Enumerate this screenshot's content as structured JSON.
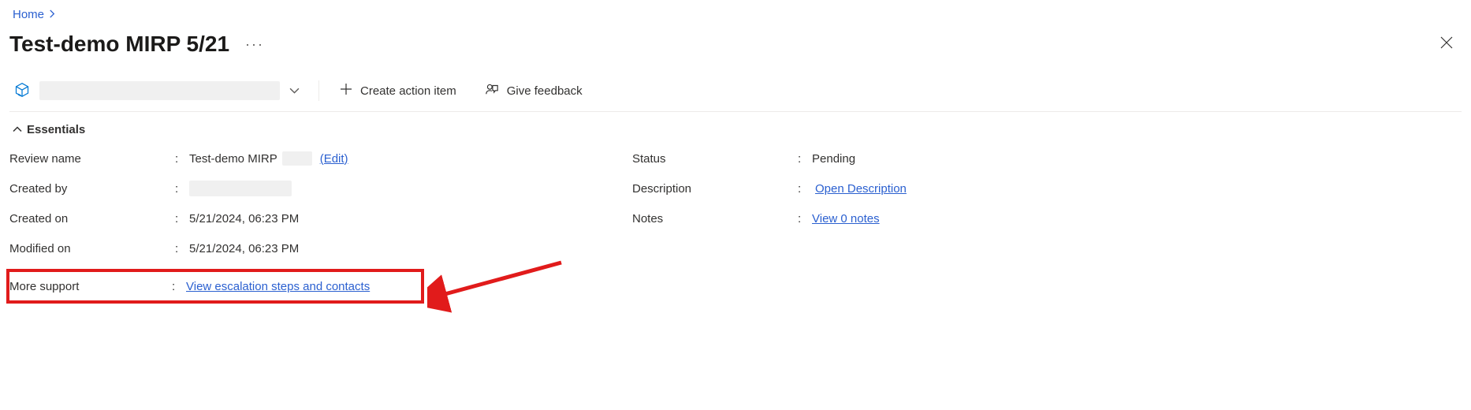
{
  "breadcrumb": {
    "home": "Home"
  },
  "title": "Test-demo MIRP 5/21",
  "toolbar": {
    "create_action": "Create action item",
    "give_feedback": "Give feedback"
  },
  "essentials": {
    "heading": "Essentials",
    "left": {
      "review_name_label": "Review name",
      "review_name_value": "Test-demo MIRP",
      "edit_link": "(Edit)",
      "created_by_label": "Created by",
      "created_on_label": "Created on",
      "created_on_value": "5/21/2024, 06:23 PM",
      "modified_on_label": "Modified on",
      "modified_on_value": "5/21/2024, 06:23 PM",
      "more_support_label": "More support",
      "more_support_link": "View escalation steps and contacts"
    },
    "right": {
      "status_label": "Status",
      "status_value": "Pending",
      "description_label": "Description",
      "description_link": "Open Description",
      "notes_label": "Notes",
      "notes_link": "View 0 notes"
    }
  }
}
